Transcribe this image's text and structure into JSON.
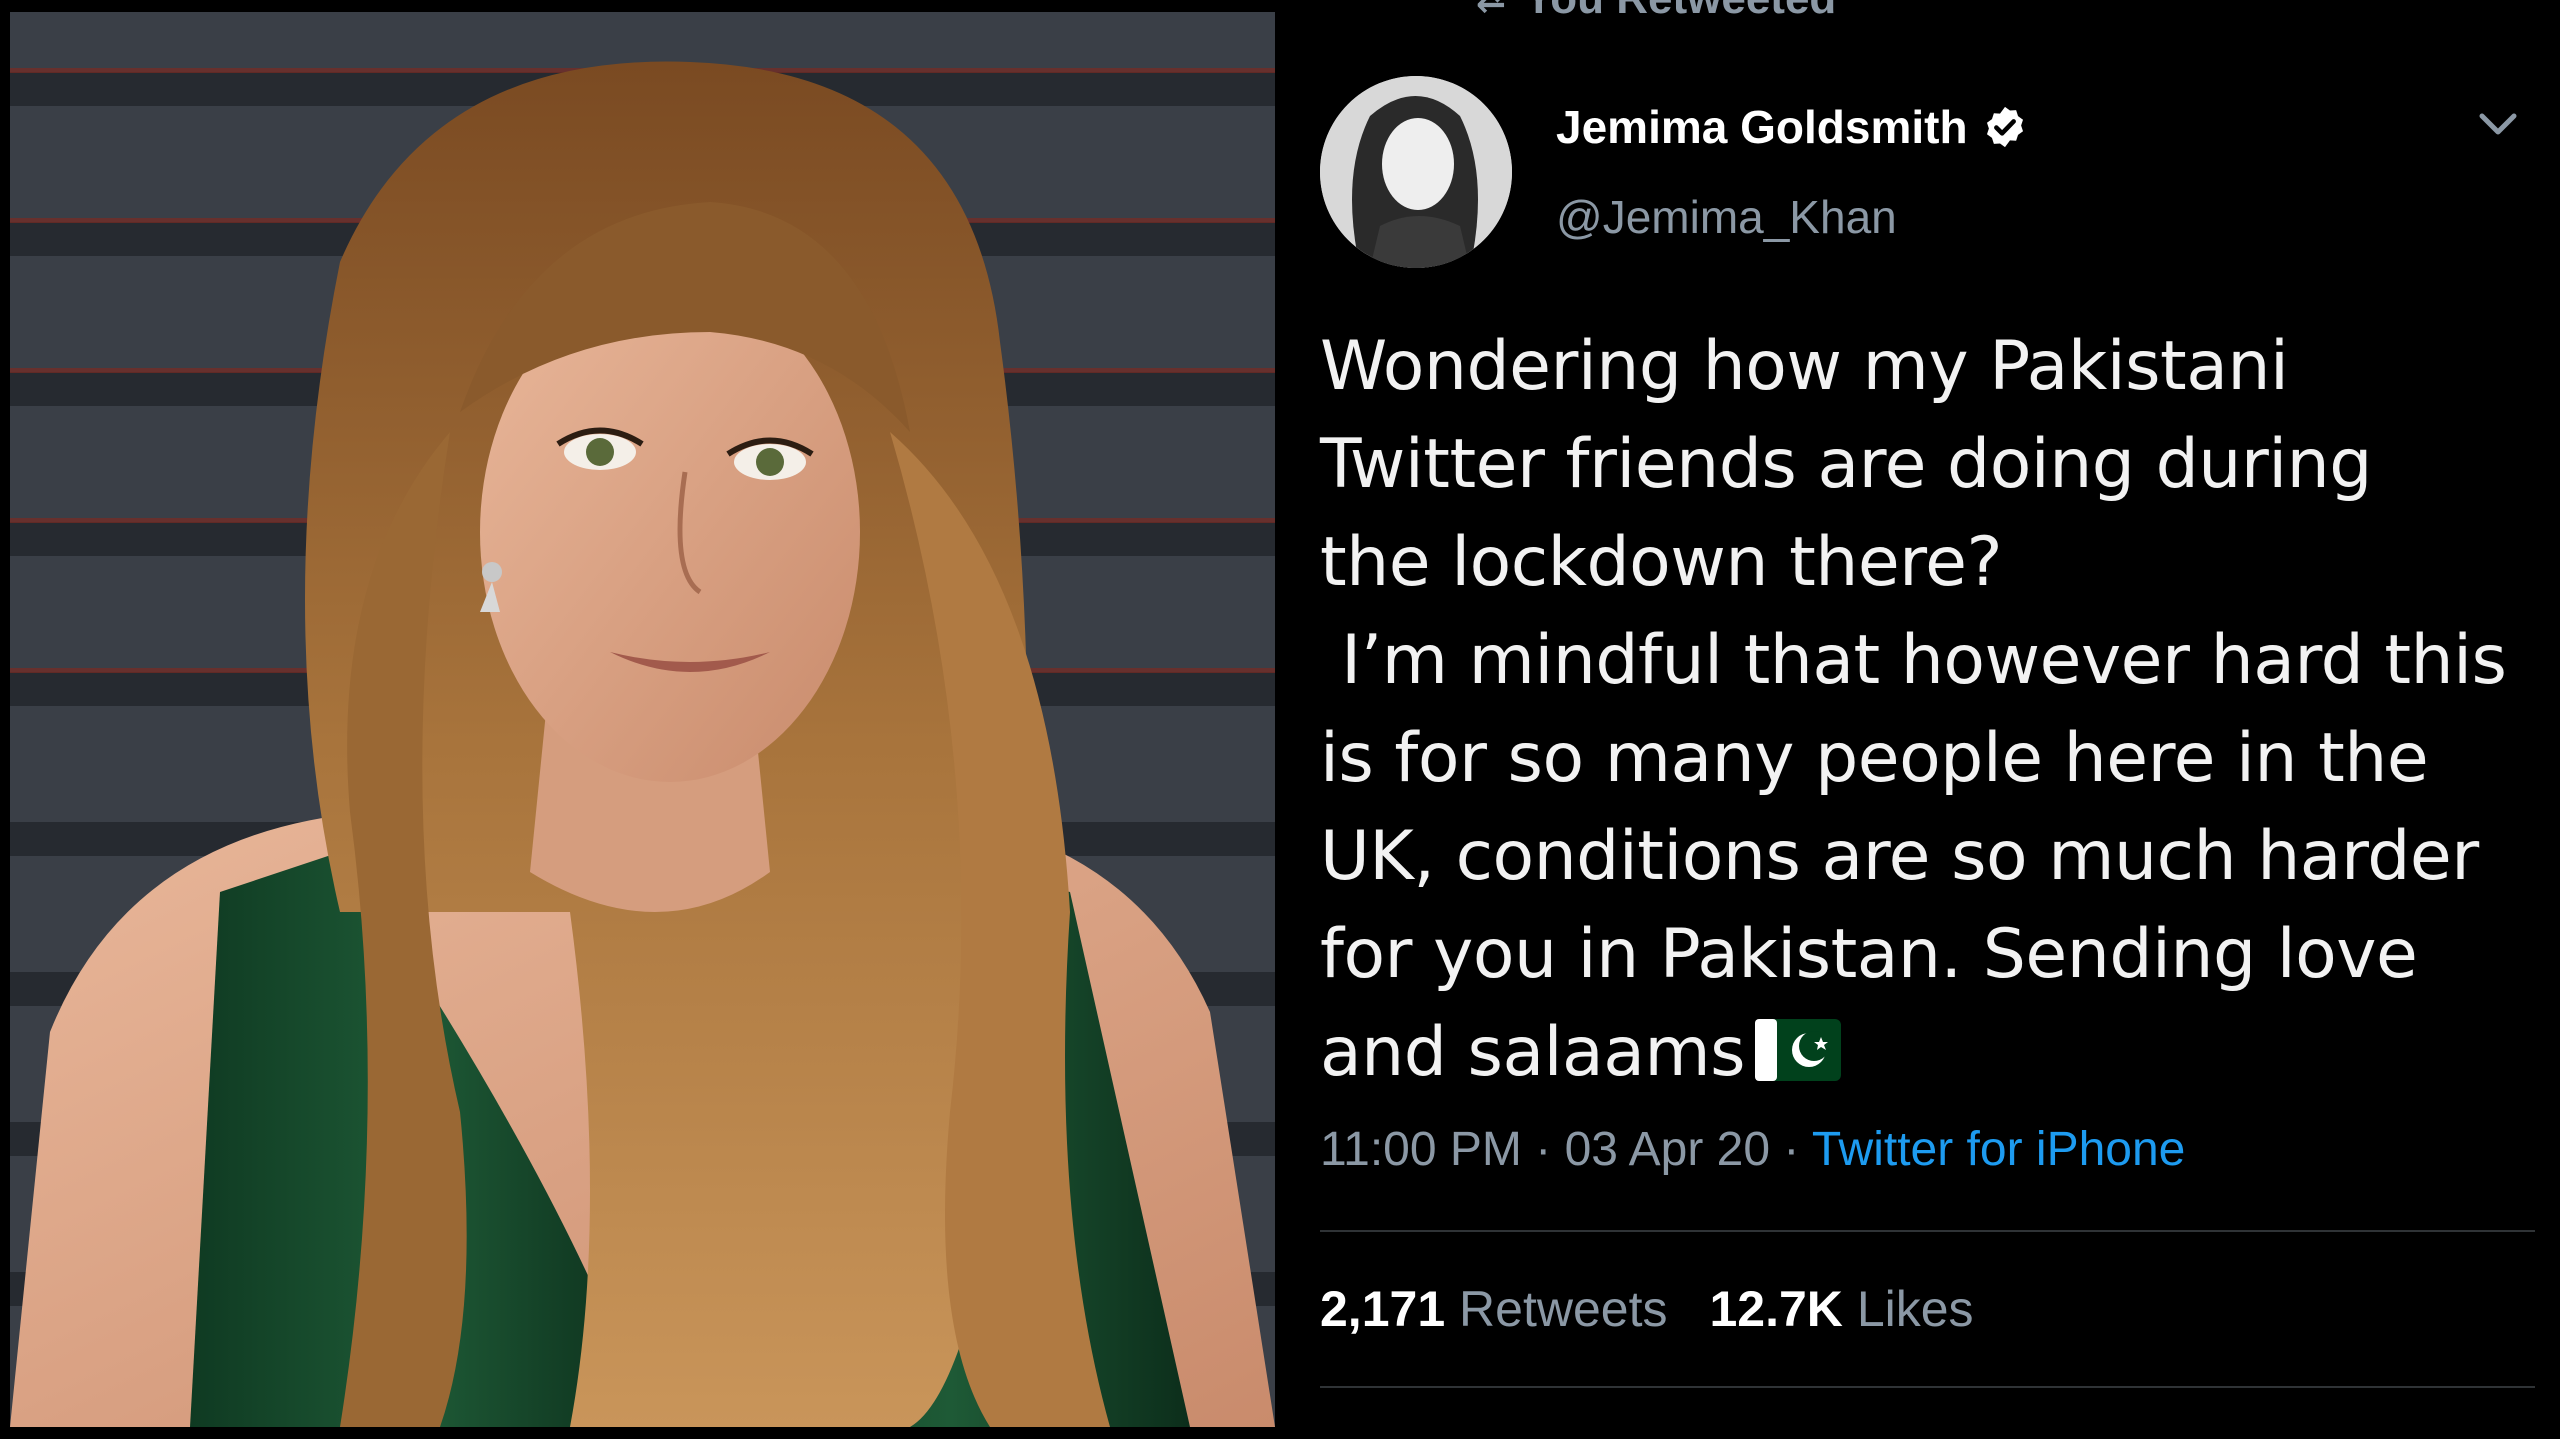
{
  "retweet_header": {
    "label": "You Retweeted"
  },
  "tweet": {
    "author_name": "Jemima Goldsmith",
    "author_handle": "@Jemima_Khan",
    "verified": true,
    "text_lines": [
      "Wondering how my Pakistani",
      "Twitter friends are doing during",
      "the lockdown there?",
      " I’m mindful that however hard this",
      "is for so many people here in the",
      "UK, conditions are so much harder",
      "for you in Pakistan. Sending love",
      "and salaams"
    ],
    "emoji": "pakistan-flag",
    "time": "11:00 PM",
    "date": "03 Apr 20",
    "separator": "·",
    "source": "Twitter for iPhone",
    "retweets_count": "2,171",
    "retweets_label": "Retweets",
    "likes_count": "12.7K",
    "likes_label": "Likes"
  },
  "colors": {
    "background": "#000000",
    "text": "#f2f2f2",
    "muted": "#8b98a5",
    "link": "#1d9bf0",
    "divider": "#2f3336",
    "flag_green": "#01411C"
  },
  "icons": {
    "verified": "verified-badge-icon",
    "menu": "chevron-down-icon",
    "retweet": "retweet-icon"
  }
}
